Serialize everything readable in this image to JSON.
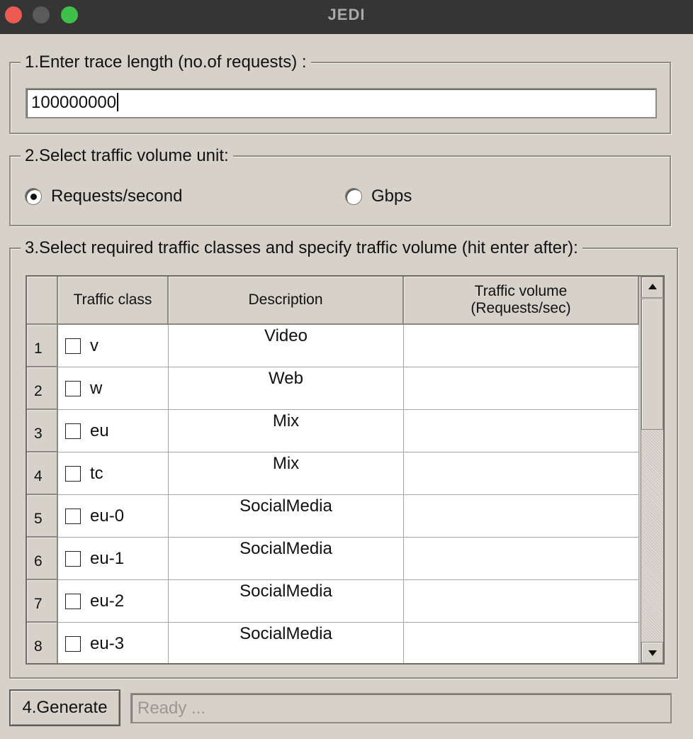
{
  "window": {
    "title": "JEDI"
  },
  "step1": {
    "label": "1.Enter trace length (no.of requests) :",
    "value": "100000000"
  },
  "step2": {
    "label": "2.Select traffic volume unit:",
    "options": [
      {
        "label": "Requests/second",
        "selected": true
      },
      {
        "label": "Gbps",
        "selected": false
      }
    ]
  },
  "step3": {
    "label": "3.Select required traffic classes and specify traffic volume (hit enter after):",
    "headers": {
      "class": "Traffic class",
      "description": "Description",
      "volume_line1": "Traffic volume",
      "volume_line2": "(Requests/sec)"
    },
    "rows": [
      {
        "num": "1",
        "class": "v",
        "description": "Video",
        "volume": "",
        "checked": false
      },
      {
        "num": "2",
        "class": "w",
        "description": "Web",
        "volume": "",
        "checked": false
      },
      {
        "num": "3",
        "class": "eu",
        "description": "Mix",
        "volume": "",
        "checked": false
      },
      {
        "num": "4",
        "class": "tc",
        "description": "Mix",
        "volume": "",
        "checked": false
      },
      {
        "num": "5",
        "class": "eu-0",
        "description": "SocialMedia",
        "volume": "",
        "checked": false
      },
      {
        "num": "6",
        "class": "eu-1",
        "description": "SocialMedia",
        "volume": "",
        "checked": false
      },
      {
        "num": "7",
        "class": "eu-2",
        "description": "SocialMedia",
        "volume": "",
        "checked": false
      },
      {
        "num": "8",
        "class": "eu-3",
        "description": "SocialMedia",
        "volume": "",
        "checked": false
      }
    ]
  },
  "step4": {
    "button_label": "4.Generate",
    "status": "Ready ..."
  },
  "colors": {
    "close": "#ec5b52",
    "minimize": "#5a5a5a",
    "maximize": "#3fc04a",
    "background": "#d6d2ca",
    "titlebar": "#353535"
  }
}
